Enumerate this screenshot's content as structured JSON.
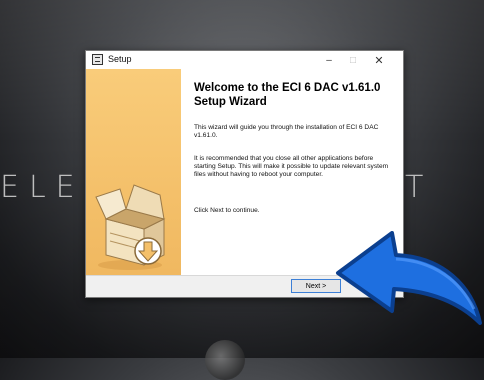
{
  "background": {
    "logo_text_left": "ELEC",
    "logo_text_right": "T"
  },
  "window": {
    "title": "Setup",
    "icon": "installer-icon",
    "controls": {
      "minimize": "–",
      "maximize": "□",
      "close": "✕"
    }
  },
  "wizard": {
    "heading": "Welcome to the ECI 6 DAC v1.61.0 Setup Wizard",
    "paragraph_1": "This wizard will guide you through the installation of ECI 6 DAC v1.61.0.",
    "paragraph_2": "It is recommended that you close all other applications before starting Setup. This will make it possible to update relevant system files without having to reboot your computer.",
    "paragraph_3": "Click Next to continue.",
    "side_image": "install-box-icon",
    "accent_color": "#f4c06a"
  },
  "footer": {
    "next_label": "Next >"
  },
  "overlay": {
    "arrow": "blue-curved-arrow",
    "arrow_color": "#1e6fe0"
  }
}
